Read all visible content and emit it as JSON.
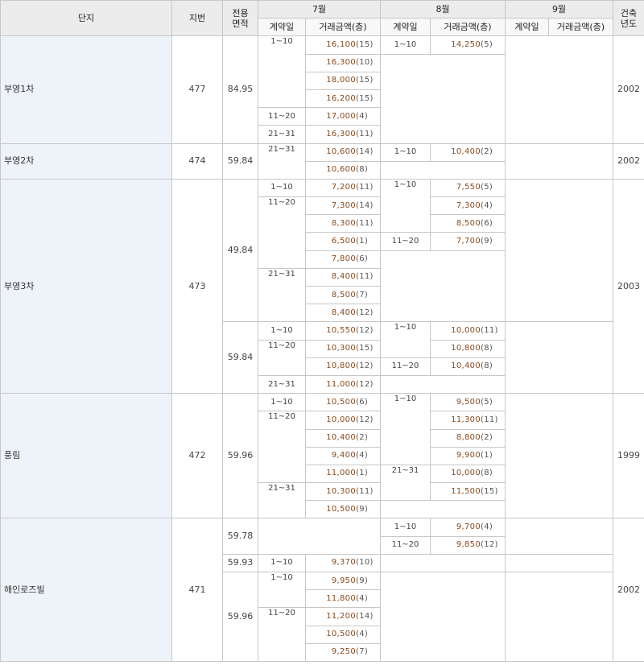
{
  "headers": {
    "danji": "단지",
    "jibeon": "지번",
    "area": "전용\n면적",
    "m7": "7월",
    "m8": "8월",
    "m9": "9월",
    "year": "건축\n년도",
    "contract_day": "계약일",
    "amount": "거래금액(층)"
  },
  "rows": [
    {
      "d7": "1~10",
      "p7": "16,100",
      "c7": "(15)",
      "d8": "1~10",
      "p8": "14,250",
      "c8": "(5)"
    },
    {
      "p7": "16,300",
      "c7": "(10)"
    },
    {
      "p7": "18,000",
      "c7": "(15)"
    },
    {
      "p7": "16,200",
      "c7": "(15)"
    },
    {
      "d7": "11~20",
      "p7": "17,000",
      "c7": "(4)"
    },
    {
      "d7": "21~31",
      "p7": "16,300",
      "c7": "(11)"
    },
    {
      "d7": "21~31",
      "p7": "10,600",
      "c7": "(14)",
      "d8": "1~10",
      "p8": "10,400",
      "c8": "(2)"
    },
    {
      "p7": "10,600",
      "c7": "(8)"
    },
    {
      "d7": "1~10",
      "p7": "7,200",
      "c7": "(11)",
      "d8": "1~10",
      "p8": "7,550",
      "c8": "(5)"
    },
    {
      "d7": "11~20",
      "p7": "7,300",
      "c7": "(14)",
      "p8": "7,300",
      "c8": "(4)"
    },
    {
      "p7": "8,300",
      "c7": "(11)",
      "p8": "8,500",
      "c8": "(6)"
    },
    {
      "p7": "6,500",
      "c7": "(1)",
      "d8": "11~20",
      "p8": "7,700",
      "c8": "(9)"
    },
    {
      "p7": "7,800",
      "c7": "(6)"
    },
    {
      "d7": "21~31",
      "p7": "8,400",
      "c7": "(11)"
    },
    {
      "p7": "8,500",
      "c7": "(7)"
    },
    {
      "p7": "8,400",
      "c7": "(12)"
    },
    {
      "d7": "1~10",
      "p7": "10,550",
      "c7": "(12)",
      "d8": "1~10",
      "p8": "10,000",
      "c8": "(11)"
    },
    {
      "d7": "11~20",
      "p7": "10,300",
      "c7": "(15)",
      "p8": "10,800",
      "c8": "(8)"
    },
    {
      "p7": "10,800",
      "c7": "(12)",
      "d8": "11~20",
      "p8": "10,400",
      "c8": "(8)"
    },
    {
      "d7": "21~31",
      "p7": "11,000",
      "c7": "(12)"
    },
    {
      "d7": "1~10",
      "p7": "10,500",
      "c7": "(6)",
      "d8": "1~10",
      "p8": "9,500",
      "c8": "(5)"
    },
    {
      "d7": "11~20",
      "p7": "10,000",
      "c7": "(12)",
      "p8": "11,300",
      "c8": "(11)"
    },
    {
      "p7": "10,400",
      "c7": "(2)",
      "p8": "8,800",
      "c8": "(2)"
    },
    {
      "p7": "9,400",
      "c7": "(4)",
      "p8": "9,900",
      "c8": "(1)"
    },
    {
      "p7": "11,000",
      "c7": "(1)",
      "d8": "21~31",
      "p8": "10,000",
      "c8": "(8)"
    },
    {
      "d7": "21~31",
      "p7": "10,300",
      "c7": "(11)",
      "p8": "11,500",
      "c8": "(15)"
    },
    {
      "p7": "10,500",
      "c7": "(9)"
    },
    {
      "d8": "1~10",
      "p8": "9,700",
      "c8": "(4)"
    },
    {
      "d8": "11~20",
      "p8": "9,850",
      "c8": "(12)"
    },
    {
      "d7": "1~10",
      "p7": "9,370",
      "c7": "(10)"
    },
    {
      "d7": "1~10",
      "p7": "9,950",
      "c7": "(9)"
    },
    {
      "p7": "11,800",
      "c7": "(4)"
    },
    {
      "d7": "11~20",
      "p7": "11,200",
      "c7": "(14)"
    },
    {
      "p7": "10,500",
      "c7": "(4)"
    },
    {
      "p7": "9,250",
      "c7": "(7)"
    }
  ],
  "complexes": [
    {
      "name": "부영1차",
      "jibeon": "477",
      "year": "2002",
      "areas": [
        "84.95"
      ]
    },
    {
      "name": "부영2차",
      "jibeon": "474",
      "year": "2002",
      "areas": [
        "59.84"
      ]
    },
    {
      "name": "부영3차",
      "jibeon": "473",
      "year": "2003",
      "areas": [
        "49.84",
        "59.84"
      ]
    },
    {
      "name": "풍림",
      "jibeon": "472",
      "year": "1999",
      "areas": [
        "59.96"
      ]
    },
    {
      "name": "해인로즈빌",
      "jibeon": "471",
      "year": "2002",
      "areas": [
        "59.78",
        "59.93",
        "59.96"
      ]
    }
  ]
}
